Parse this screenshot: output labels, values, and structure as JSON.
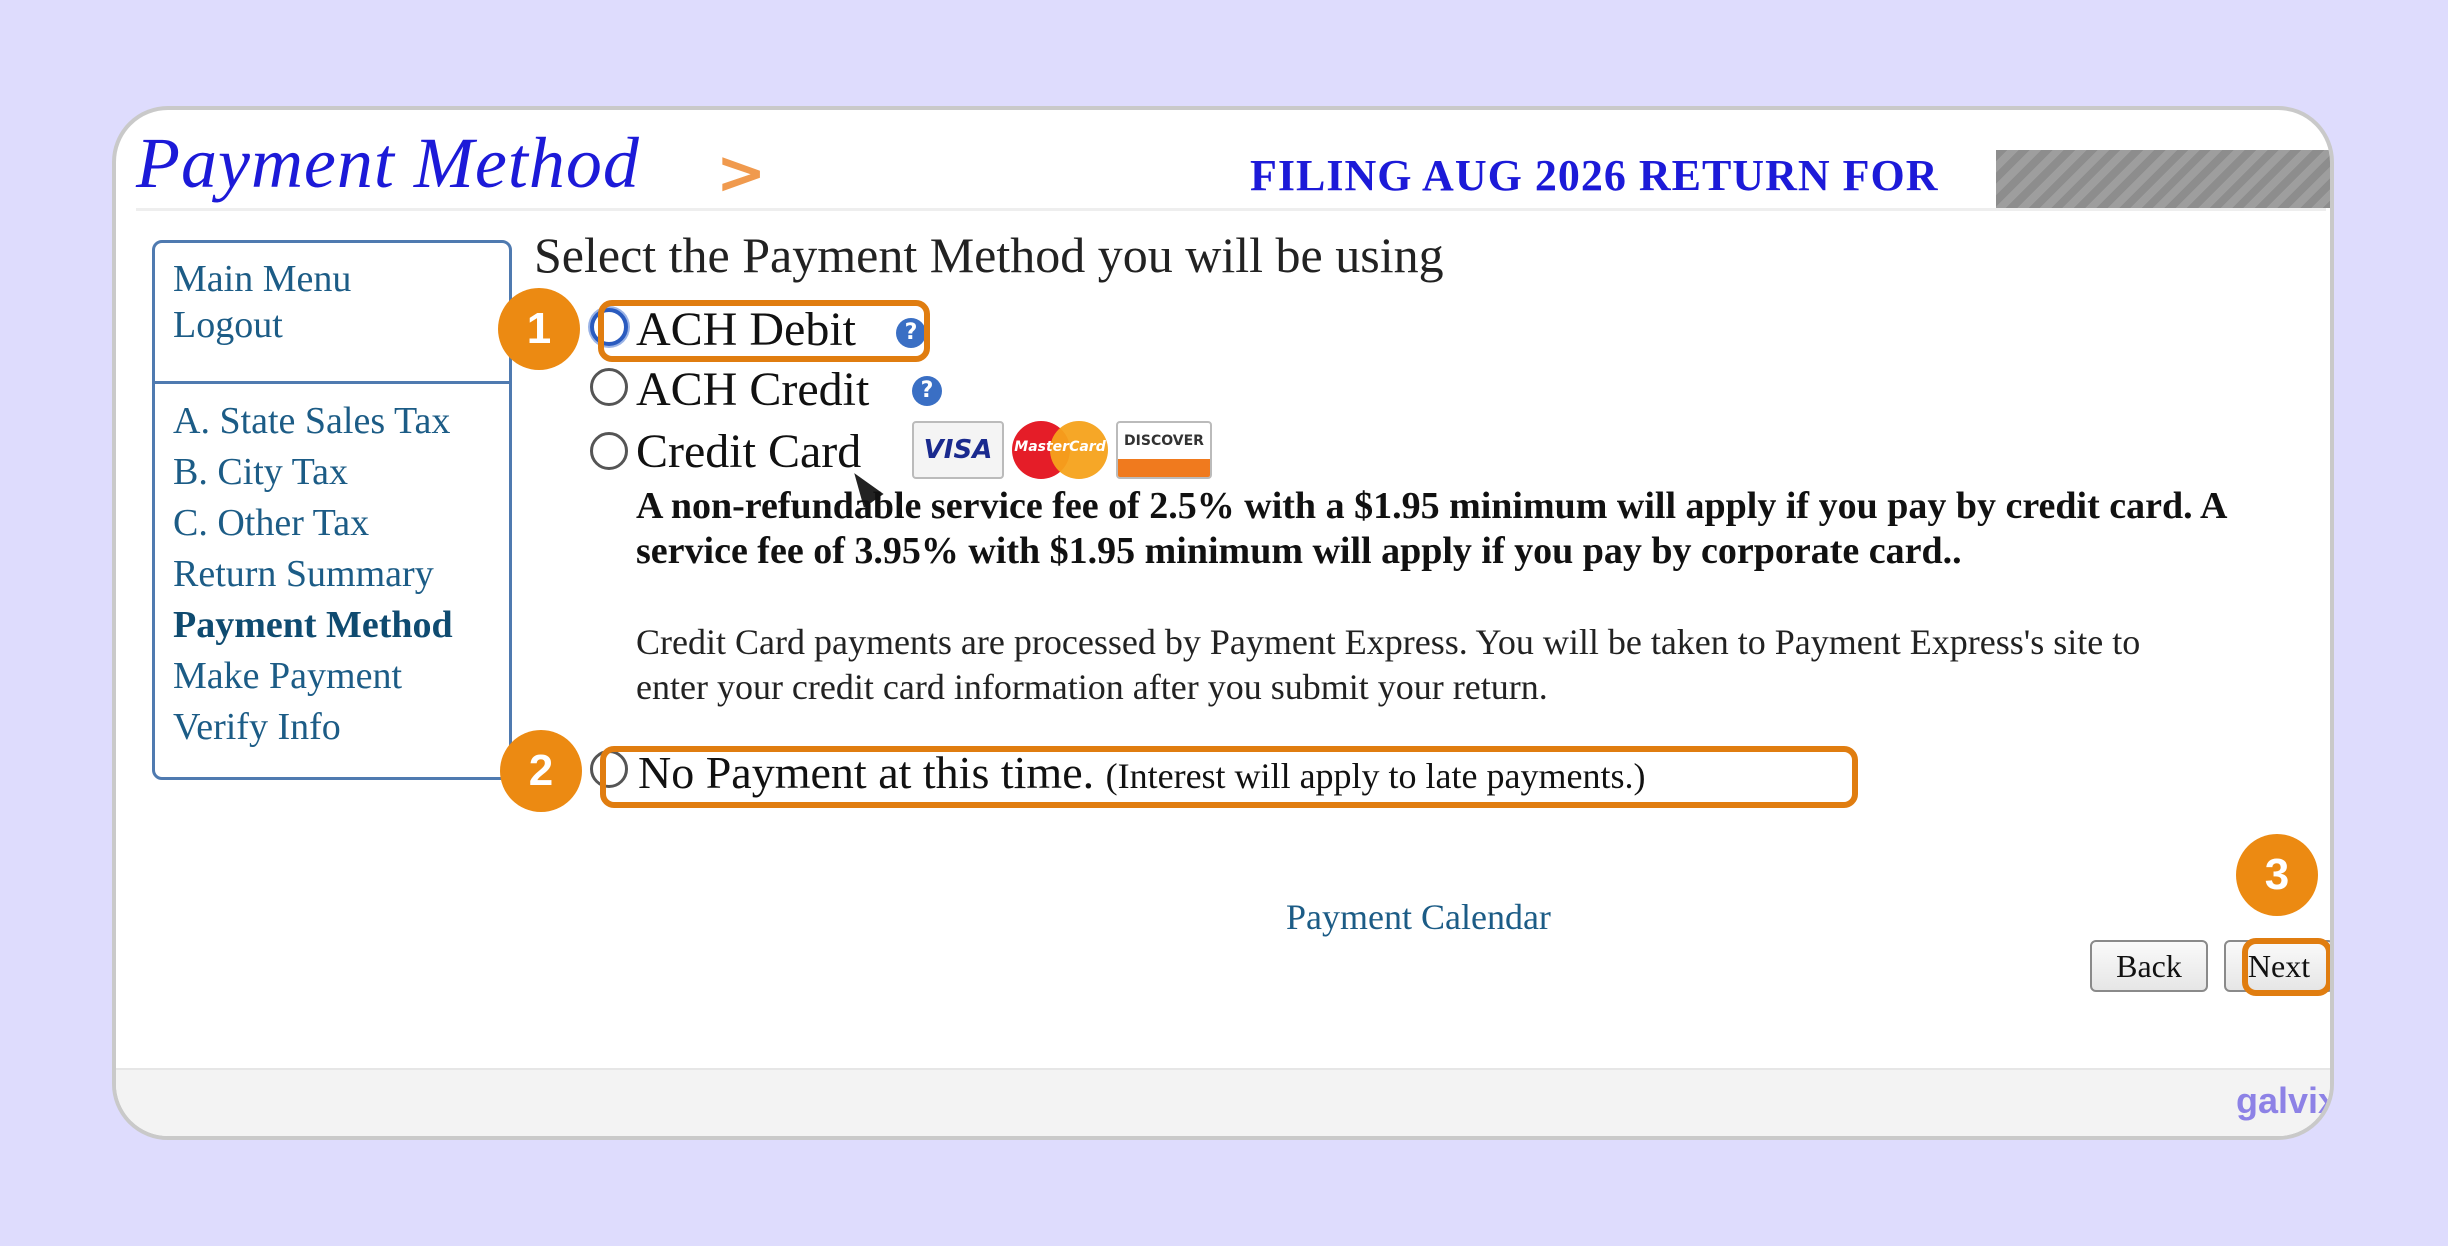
{
  "header": {
    "title": "Payment Method",
    "filing_text": "FILING AUG 2026 RETURN FOR"
  },
  "sidebar": {
    "top_links": [
      "Main Menu",
      "Logout"
    ],
    "items": [
      {
        "label": "A. State Sales Tax",
        "active": false
      },
      {
        "label": "B. City Tax",
        "active": false
      },
      {
        "label": "C. Other Tax",
        "active": false
      },
      {
        "label": "Return Summary",
        "active": false
      },
      {
        "label": "Payment Method",
        "active": true
      },
      {
        "label": "Make Payment",
        "active": false
      },
      {
        "label": "Verify Info",
        "active": false
      }
    ]
  },
  "main": {
    "prompt": "Select the Payment Method you will be using",
    "options": {
      "ach_debit": "ACH Debit",
      "ach_credit": "ACH Credit",
      "credit_card": "Credit Card"
    },
    "card_logos": {
      "visa": "VISA",
      "mastercard": "MasterCard",
      "discover": "DISCOVER"
    },
    "fee_notice": "A non-refundable service fee of 2.5% with a $1.95 minimum will apply if you pay by credit card. A service fee of 3.95% with $1.95 minimum will apply if you pay by corporate card..",
    "processor_note": "Credit Card payments are processed by Payment Express. You will be taken to Payment Express's site to enter your credit card information after you submit your return.",
    "no_payment_label": "No Payment at this time.",
    "no_payment_note": "(Interest will apply to late payments.)",
    "calendar_link": "Payment Calendar"
  },
  "buttons": {
    "back": "Back",
    "next": "Next"
  },
  "annotations": {
    "step1": "1",
    "step2": "2",
    "step3": "3",
    "highlight_color": "#e07d10"
  },
  "watermark": "galvix.com",
  "icons": [
    "help-icon",
    "arrow-right-icon",
    "cursor-icon"
  ]
}
